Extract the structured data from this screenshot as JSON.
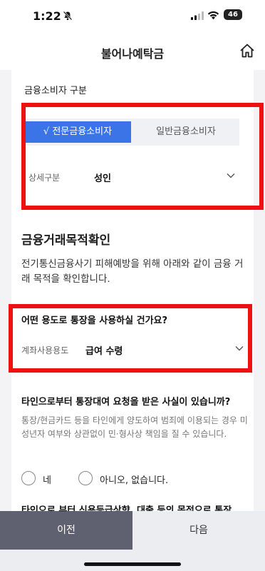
{
  "status": {
    "time": "1:22",
    "battery": "46"
  },
  "header": {
    "title": "불어나예탁금"
  },
  "category": {
    "label": "금융소비자 구분",
    "options": [
      "√ 전문금융소비자",
      "일반금융소비자"
    ],
    "selected_index": 0,
    "detail_label": "상세구분",
    "detail_value": "성인"
  },
  "purpose": {
    "title": "금융거래목적확인",
    "description": "전기통신금융사기 피해예방을 위해 아래와 같이 금융 거래 목적을 확인합니다.",
    "question": "어떤 용도로 통장을 사용하실 건가요?",
    "usage_label": "계좌사용용도",
    "usage_value": "급여 수령"
  },
  "loan_question": {
    "question": "타인으로부터 통장대여 요청을 받은 사실이 있습니까?",
    "description": "통장/현금카드 등을 타인에게 양도하여 범죄에 이용되는 경우 미성년자 여부와 상관없이 민·형사상 책임을 질 수 있습니다.",
    "options": [
      "네",
      "아니오, 없습니다."
    ],
    "next_question": "타인으로 부터 신용등급상향, 대출 등의 목적으로 통장"
  },
  "footer": {
    "prev_label": "이전",
    "next_label": "다음"
  },
  "colors": {
    "accent": "#3b74e6",
    "highlight_frame": "#ee1111",
    "prev_button": "#5f6170"
  }
}
